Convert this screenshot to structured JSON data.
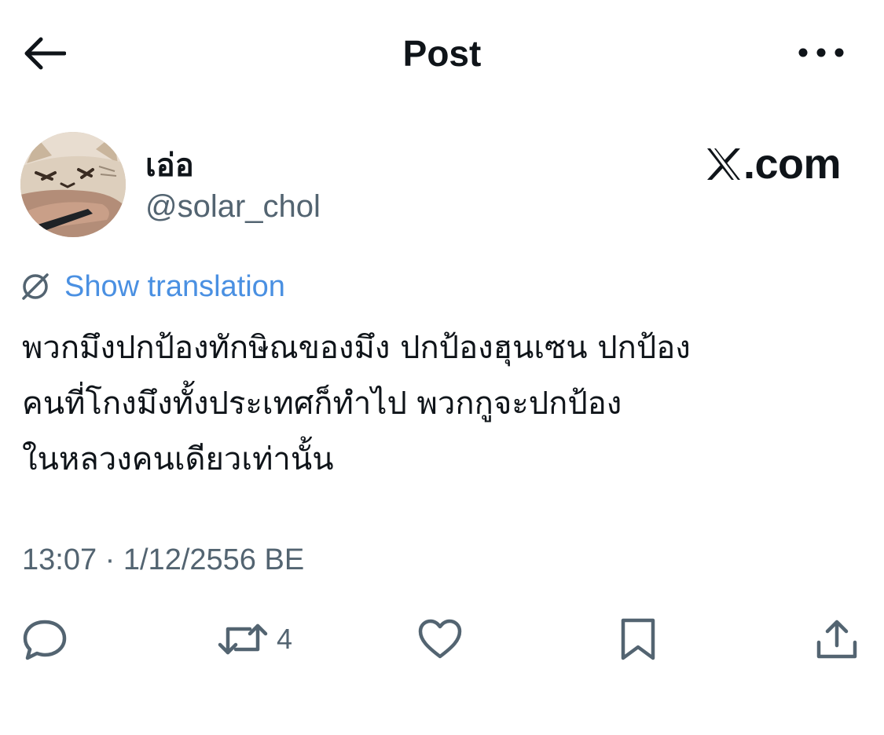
{
  "header": {
    "title": "Post",
    "back_icon": "arrow-left-icon",
    "more_icon": "more-dots-icon"
  },
  "author": {
    "display_name": "เอ่อ",
    "handle": "@solar_chol",
    "avatar_icon": "cat-avatar-icon"
  },
  "watermark": {
    "text": ".com",
    "logo_icon": "x-logo-icon"
  },
  "translate": {
    "label": "Show translation",
    "icon": "translate-globe-icon"
  },
  "post": {
    "lines": [
      "พวกมึงปกป้องทักษิณของมึง ปกป้องฮุนเซน ปกป้อง",
      "คนที่โกงมึงทั้งประเทศก็ทำไป พวกกูจะปกป้อง",
      "ในหลวงคนเดียวเท่านั้น"
    ]
  },
  "meta": {
    "timestamp": "13:07 · 1/12/2556 BE"
  },
  "actions": {
    "reply": {
      "icon": "reply-icon"
    },
    "repost": {
      "icon": "repost-icon",
      "count": "4"
    },
    "like": {
      "icon": "heart-icon"
    },
    "bookmark": {
      "icon": "bookmark-icon"
    },
    "share": {
      "icon": "share-icon"
    }
  },
  "colors": {
    "text": "#0f1419",
    "secondary": "#536471",
    "link": "#4a90e2"
  }
}
